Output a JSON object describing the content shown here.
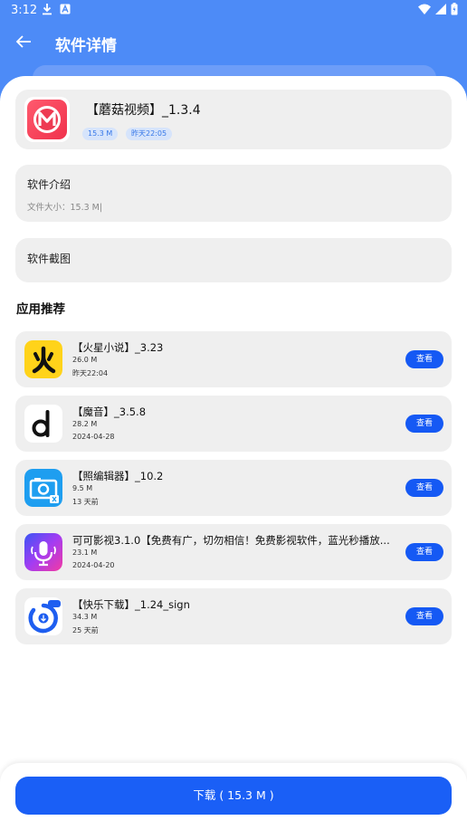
{
  "status_bar": {
    "time": "3:12"
  },
  "app_bar": {
    "title": "软件详情"
  },
  "app": {
    "name": "【蘑菇视频】_1.3.4",
    "size_tag": "15.3 M",
    "time_tag": "昨天22:05",
    "icon": "mogu-m-icon"
  },
  "intro": {
    "title": "软件介绍",
    "detail": "文件大小：15.3 M|"
  },
  "screenshots": {
    "title": "软件截图"
  },
  "recommend": {
    "title": "应用推荐",
    "button_label": "查看",
    "items": [
      {
        "name": "【火星小说】_3.23",
        "size": "26.0 M",
        "date": "昨天22:04",
        "icon": "huoxing-icon"
      },
      {
        "name": "【魔音】_3.5.8",
        "size": "28.2 M",
        "date": "2024-04-28",
        "icon": "moyin-d-icon"
      },
      {
        "name": "【照编辑器】_10.2",
        "size": "9.5 M",
        "date": "13 天前",
        "icon": "camera-icon"
      },
      {
        "name": "可可影视3.1.0【免费有广，切勿相信！免费影视软件，蓝光秒播放...",
        "size": "23.1 M",
        "date": "2024-04-20",
        "icon": "microphone-icon"
      },
      {
        "name": "【快乐下载】_1.24_sign",
        "size": "34.3 M",
        "date": "25 天前",
        "icon": "download-circle-icon"
      }
    ]
  },
  "download": {
    "label": "下载 ( 15.3 M )"
  },
  "colors": {
    "header": "#4d8bf7",
    "primary": "#1a5ff6",
    "card": "#efefef",
    "tag_bg": "#d6e4fb"
  }
}
